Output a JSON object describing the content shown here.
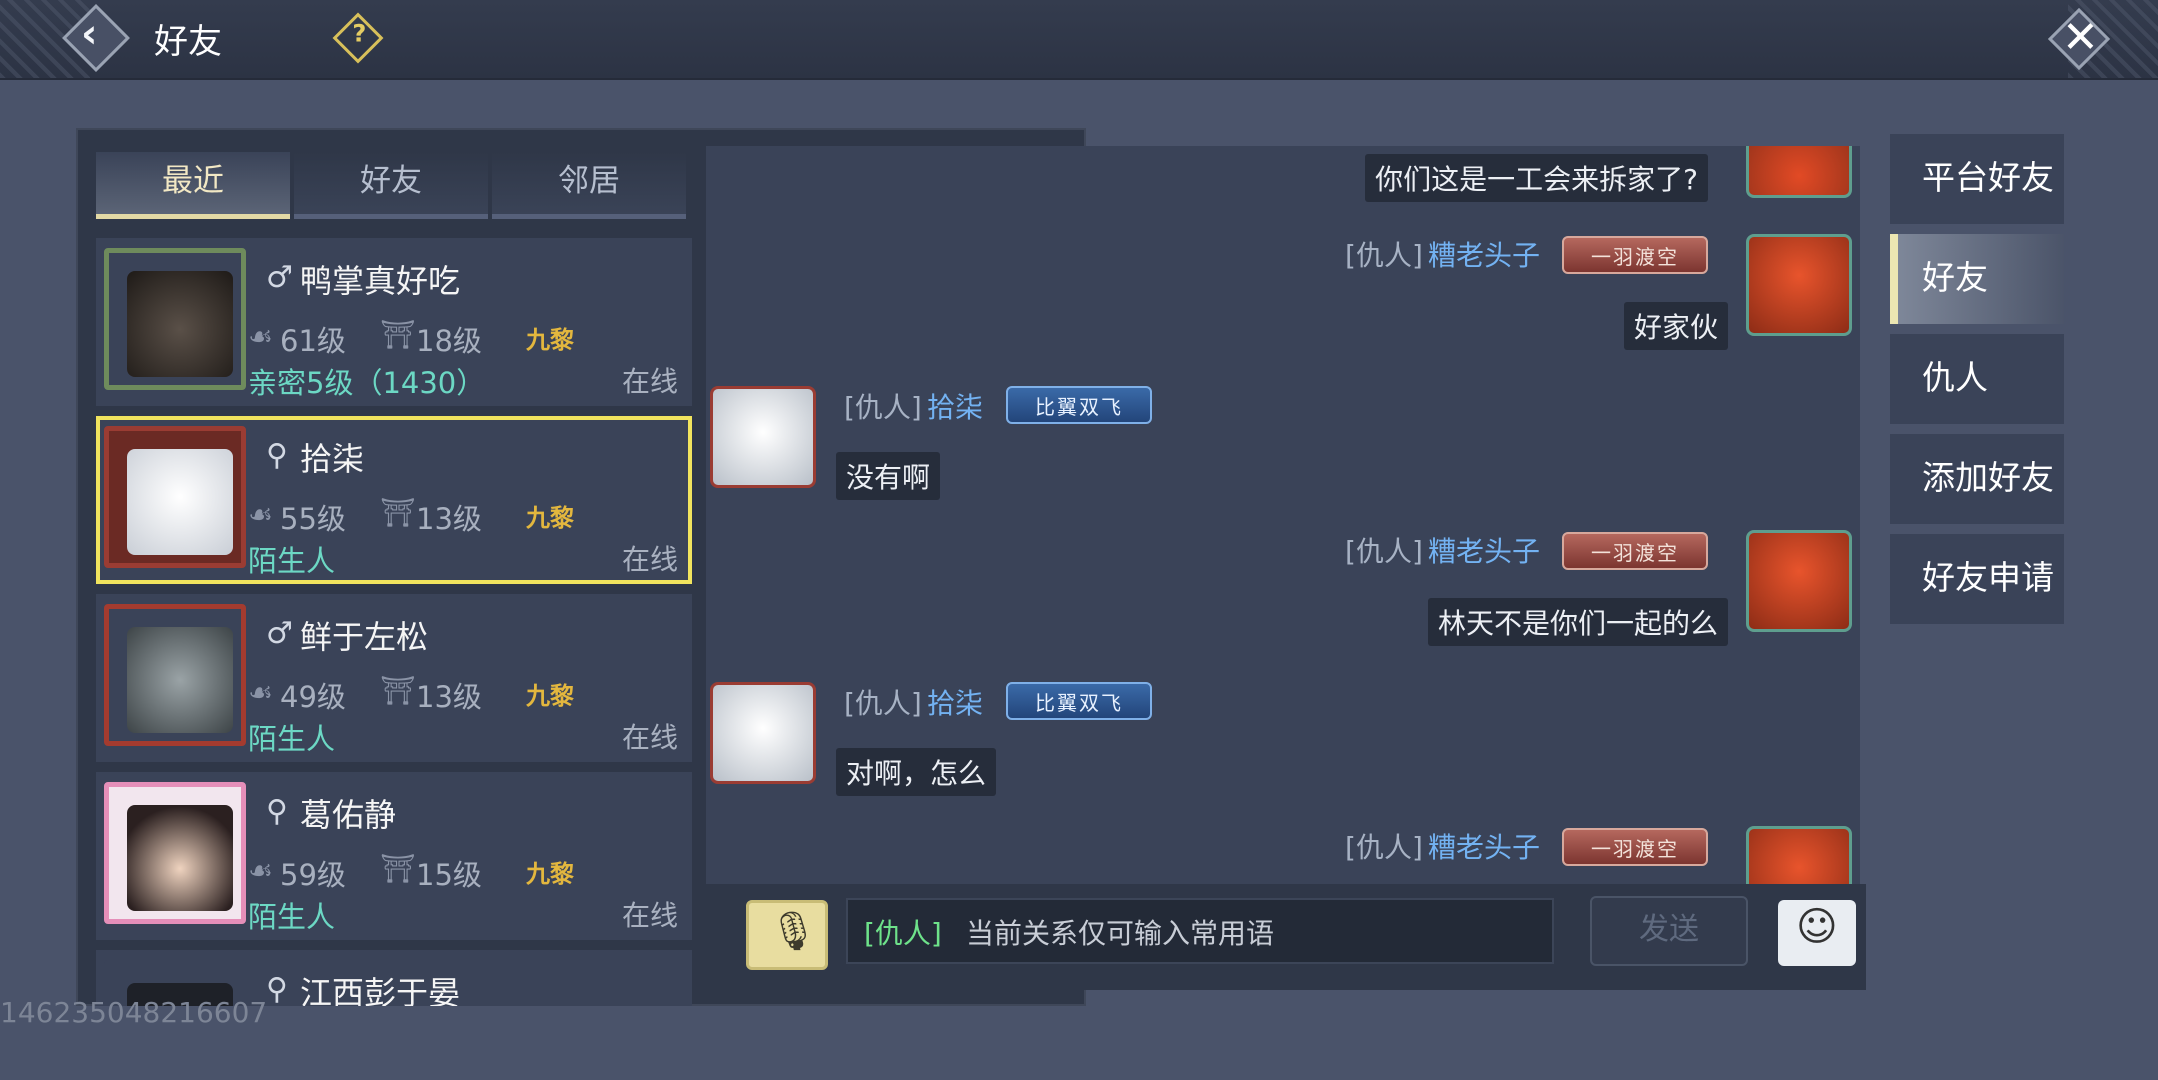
{
  "header": {
    "title": "好友",
    "help_label": "?"
  },
  "tabs": [
    {
      "label": "最近",
      "active": true
    },
    {
      "label": "好友",
      "active": false
    },
    {
      "label": "邻居",
      "active": false
    }
  ],
  "friends": [
    {
      "gender_icon": "male-icon",
      "gender_symbol": "♂",
      "name": "鸭掌真好吃",
      "level": "61级",
      "house_level": "18级",
      "guild": "九黎",
      "relation": "亲密5级（1430）",
      "status": "在线",
      "selected": false,
      "avatar_color": "#3a3530",
      "frame_color": "#6e8b5c"
    },
    {
      "gender_icon": "female-icon",
      "gender_symbol": "⚲",
      "name": "拾柒",
      "level": "55级",
      "house_level": "13级",
      "guild": "九黎",
      "relation": "陌生人",
      "status": "在线",
      "selected": true,
      "avatar_color": "#dfe3e8",
      "frame_color": "#9a3c33"
    },
    {
      "gender_icon": "male-icon",
      "gender_symbol": "♂",
      "name": "鲜于左松",
      "level": "49级",
      "house_level": "13级",
      "guild": "九黎",
      "relation": "陌生人",
      "status": "在线",
      "selected": false,
      "avatar_color": "#6a7478",
      "frame_color": "#a43b2f"
    },
    {
      "gender_icon": "female-icon",
      "gender_symbol": "⚲",
      "name": "葛佑静",
      "level": "59级",
      "house_level": "15级",
      "guild": "九黎",
      "relation": "陌生人",
      "status": "在线",
      "selected": false,
      "avatar_color": "#e7c9b4",
      "frame_color": "#e58fb9"
    },
    {
      "gender_icon": "female-icon",
      "gender_symbol": "⚲",
      "name": "江西彭于晏",
      "level": "",
      "house_level": "",
      "guild": "",
      "relation": "",
      "status": "",
      "selected": false,
      "avatar_color": "#1e2128",
      "frame_color": "#3a4358"
    }
  ],
  "chat": {
    "messages": [
      {
        "side": "right",
        "tag": "",
        "name": "",
        "badge": "",
        "text": "你们这是一工会来拆家了?"
      },
      {
        "side": "right",
        "tag": "[仇人]",
        "name": "糟老头子",
        "badge": "一羽渡空",
        "text": "好家伙"
      },
      {
        "side": "left",
        "tag": "[仇人]",
        "name": "拾柒",
        "badge": "比翼双飞",
        "text": "没有啊"
      },
      {
        "side": "right",
        "tag": "[仇人]",
        "name": "糟老头子",
        "badge": "一羽渡空",
        "text": "林天不是你们一起的么"
      },
      {
        "side": "left",
        "tag": "[仇人]",
        "name": "拾柒",
        "badge": "比翼双飞",
        "text": "对啊，怎么"
      },
      {
        "side": "right",
        "tag": "[仇人]",
        "name": "糟老头子",
        "badge": "一羽渡空",
        "text": ""
      }
    ],
    "input_tag": "[仇人]",
    "input_placeholder": "当前关系仅可输入常用语",
    "send_label": "发送"
  },
  "side_menu": [
    {
      "label": "平台好友",
      "active": false
    },
    {
      "label": "好友",
      "active": true
    },
    {
      "label": "仇人",
      "active": false
    },
    {
      "label": "添加好友",
      "active": false
    },
    {
      "label": "好友申请",
      "active": false
    }
  ],
  "watermark": "146235048216607",
  "colors": {
    "selected_border": "#f1e45e",
    "relation_text": "#6cd8c4",
    "username": "#73b2f2",
    "guild": "#e3b73e"
  }
}
